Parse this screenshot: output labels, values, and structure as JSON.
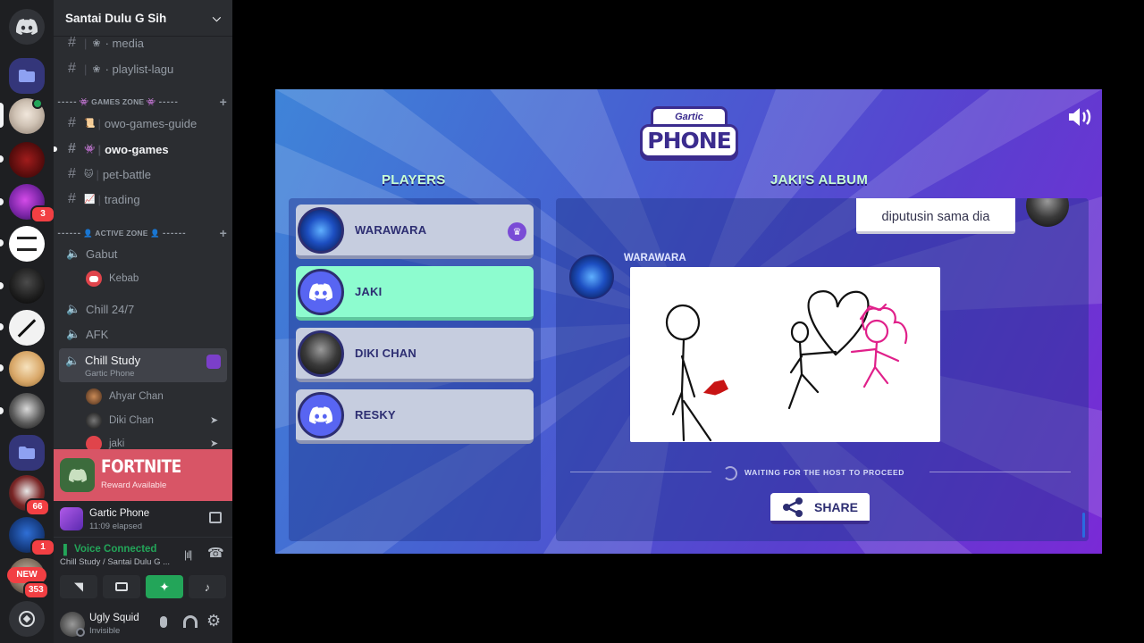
{
  "server": {
    "name": "Santai Dulu G Sih"
  },
  "server_badges": {
    "b1": "3",
    "b2": "66",
    "b3": "1",
    "b4": "353",
    "new_label": "NEW"
  },
  "channels_top": [
    {
      "icon": "❀",
      "name": "· media"
    },
    {
      "icon": "❀",
      "name": "· playlist-lagu"
    }
  ],
  "categories": {
    "games": "⁃⁃⁃⁃⁃ 👾 GAMES ZONE 👾 ⁃⁃⁃⁃⁃",
    "active": "⁃⁃⁃⁃⁃⁃ 👤 ACTIVE ZONE 👤 ⁃⁃⁃⁃⁃⁃"
  },
  "channels_games": [
    {
      "icon": "📜",
      "name": "owo-games-guide"
    },
    {
      "icon": "👾",
      "name": "owo-games"
    },
    {
      "icon": "🐱",
      "name": "pet-battle"
    },
    {
      "icon": "📈",
      "name": "trading"
    }
  ],
  "voice": {
    "gabut": "Gabut",
    "kebab": "Kebab",
    "chill247": "Chill 24/7",
    "afk": "AFK",
    "chill_study": "Chill Study",
    "chill_study_activity": "Gartic Phone",
    "users": [
      "Ahyar Chan",
      "Diki Chan",
      "jaki"
    ]
  },
  "fortnite": {
    "title": "FORTNITE",
    "subtitle": "Reward Available"
  },
  "activity": {
    "name": "Gartic Phone",
    "elapsed": "11:09 elapsed"
  },
  "voice_status": {
    "title": "Voice Connected",
    "location": "Chill Study / Santai Dulu G ..."
  },
  "user": {
    "name": "Ugly Squid",
    "status": "Invisible"
  },
  "game": {
    "logo_top": "Gartic",
    "logo_main": "PHONE",
    "players_title": "PLAYERS",
    "album_title": "JAKI'S ALBUM",
    "players": [
      "WARAWARA",
      "JAKI",
      "DIKI CHAN",
      "RESKY"
    ],
    "bubble_text": "diputusin sama dia",
    "drawer_name": "WARAWARA",
    "waiting_text": "WAITING FOR THE HOST TO PROCEED",
    "share_label": "SHARE"
  },
  "colors": {
    "accent_green": "#23a559",
    "badge_red": "#f23f43",
    "player_highlight": "#8dfccf"
  }
}
